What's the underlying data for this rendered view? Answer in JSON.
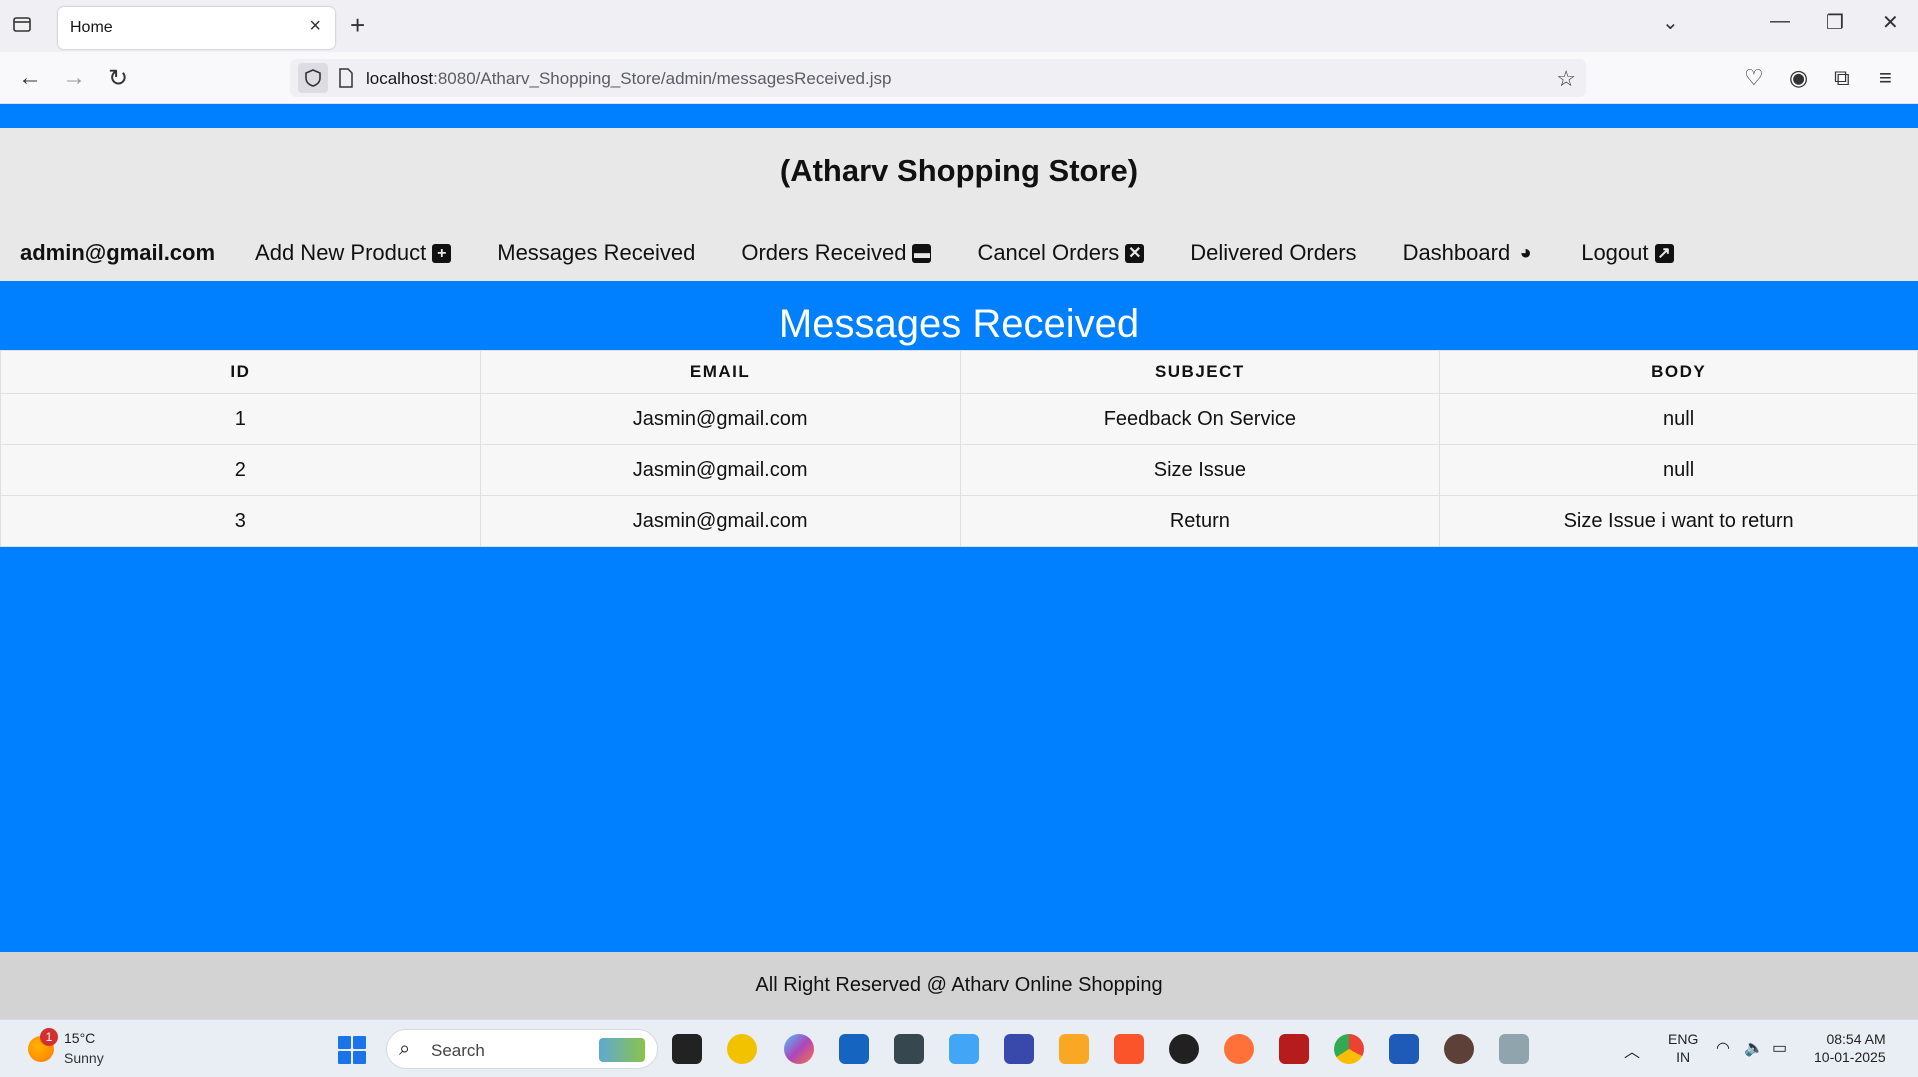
{
  "browser": {
    "tab_title": "Home",
    "url_host": "localhost",
    "url_rest": ":8080/Atharv_Shopping_Store/admin/messagesReceived.jsp"
  },
  "site": {
    "title": "(Atharv Shopping Store)",
    "user": "admin@gmail.com",
    "menu": [
      {
        "label": "Add New Product",
        "icon": "plus-square-icon",
        "glyph": "+"
      },
      {
        "label": "Messages Received",
        "icon": "",
        "glyph": ""
      },
      {
        "label": "Orders Received",
        "icon": "archive-icon",
        "glyph": "▬"
      },
      {
        "label": "Cancel Orders",
        "icon": "close-square-icon",
        "glyph": "✕"
      },
      {
        "label": "Delivered Orders",
        "icon": "",
        "glyph": ""
      },
      {
        "label": "Dashboard",
        "icon": "dashboard-icon",
        "glyph": "◕"
      },
      {
        "label": "Logout",
        "icon": "external-link-icon",
        "glyph": "↗"
      }
    ]
  },
  "messages": {
    "heading": "Messages Received",
    "columns": [
      "ID",
      "EMAIL",
      "SUBJECT",
      "BODY"
    ],
    "rows": [
      [
        "1",
        "Jasmin@gmail.com",
        "Feedback On Service",
        "null"
      ],
      [
        "2",
        "Jasmin@gmail.com",
        "Size Issue",
        "null"
      ],
      [
        "3",
        "Jasmin@gmail.com",
        "Return",
        "Size Issue i want to return"
      ]
    ]
  },
  "footer": {
    "text": "All Right Reserved @ Atharv Online Shopping"
  },
  "taskbar": {
    "weather_temp": "15°C",
    "weather_desc": "Sunny",
    "weather_badge": "1",
    "search_label": "Search",
    "lang_line1": "ENG",
    "lang_line2": "IN",
    "time": "08:54 AM",
    "date": "10-01-2025"
  },
  "colors": {
    "accent": "#0080ff",
    "header_bg": "#e8e8e8",
    "footer_bg": "#d3d3d3"
  }
}
